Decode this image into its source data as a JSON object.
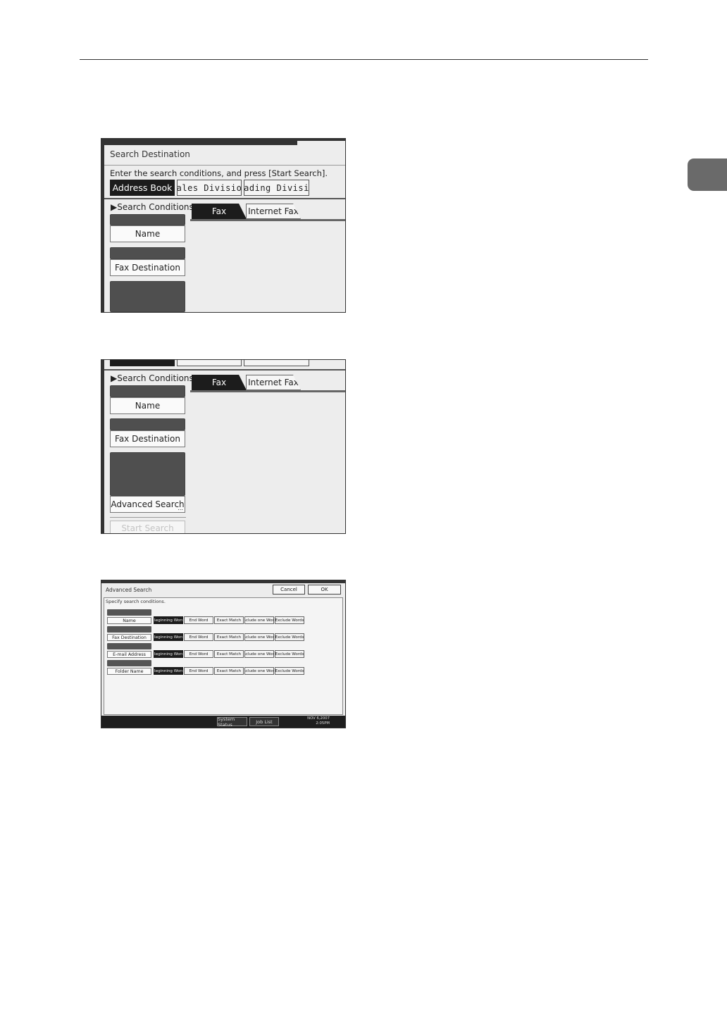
{
  "shot1": {
    "title": "Search Destination",
    "instruction": "Enter the search conditions, and press [Start Search].",
    "groups": [
      "Address Book",
      "Sales Division",
      "Trading Divisi.."
    ],
    "search_conditions_label": "Search Conditions",
    "fields": [
      "Name",
      "Fax Destination"
    ],
    "tabs": [
      "Fax",
      "Internet Fax"
    ]
  },
  "shot2": {
    "search_conditions_label": "Search Conditions",
    "fields": [
      "Name",
      "Fax Destination"
    ],
    "advanced_search": "Advanced Search",
    "start_search": "Start Search",
    "tabs": [
      "Fax",
      "Internet Fax"
    ]
  },
  "shot3": {
    "title": "Advanced Search",
    "cancel": "Cancel",
    "ok": "OK",
    "instruction": "Specify search conditions.",
    "fields": [
      "Name",
      "Fax Destination",
      "E-mail Address",
      "Folder Name"
    ],
    "options": [
      "Beginning Word",
      "End Word",
      "Exact Match",
      "Include one Word",
      "Exclude Words"
    ],
    "system_status": "System Status",
    "job_list": "Job List",
    "date": "NOV 6,2007",
    "time": "2:05PM"
  }
}
